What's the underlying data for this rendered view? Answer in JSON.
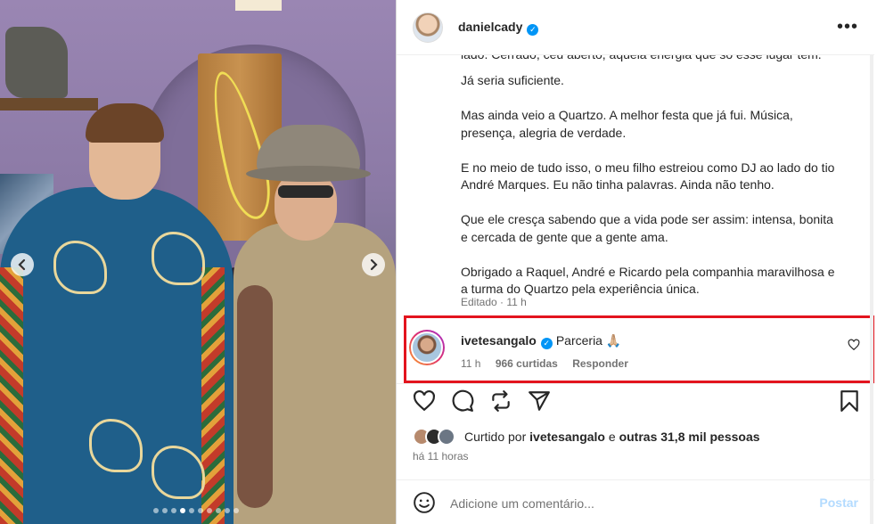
{
  "post": {
    "author": "danielcady",
    "caption_clipped": "lado. Cerrado, céu aberto, aquela energia que só esse lugar tem.",
    "caption_lines": [
      "Já seria suficiente.",
      "Mas ainda veio a Quartzo. A melhor festa que já fui. Música, presença, alegria de verdade.",
      "E no meio de tudo isso, o meu filho estreiou como DJ ao lado do tio André Marques. Eu não tinha palavras. Ainda não tenho.",
      "Que ele cresça sabendo que a vida pode ser assim: intensa, bonita e cercada de gente que a gente ama.",
      "Obrigado a Raquel, André e Ricardo pela companhia maravilhosa e a turma do Quartzo pela experiência única."
    ],
    "caption_meta": "Editado · 11 h",
    "likes": {
      "prefix": "Curtido por",
      "user": "ivetesangalo",
      "joiner": "e",
      "others": "outras 31,8 mil pessoas"
    },
    "time_ago": "há 11 horas"
  },
  "comment": {
    "user": "ivetesangalo",
    "text": "Parceria 🙏🏼",
    "time": "11 h",
    "likes": "966 curtidas",
    "reply": "Responder"
  },
  "composer": {
    "placeholder": "Adicione um comentário...",
    "post_label": "Postar"
  },
  "carousel": {
    "dot_count": 10,
    "active_index": 3
  },
  "icons": [
    "more-icon",
    "verified-badge-icon",
    "heart-icon",
    "comment-icon",
    "share-icon",
    "send-icon",
    "bookmark-icon",
    "emoji-icon",
    "chevron-left-icon",
    "chevron-right-icon"
  ],
  "colors": {
    "highlight_box": "#e3141e",
    "verified": "#0095f6",
    "post_button_disabled": "#b3dbff"
  }
}
